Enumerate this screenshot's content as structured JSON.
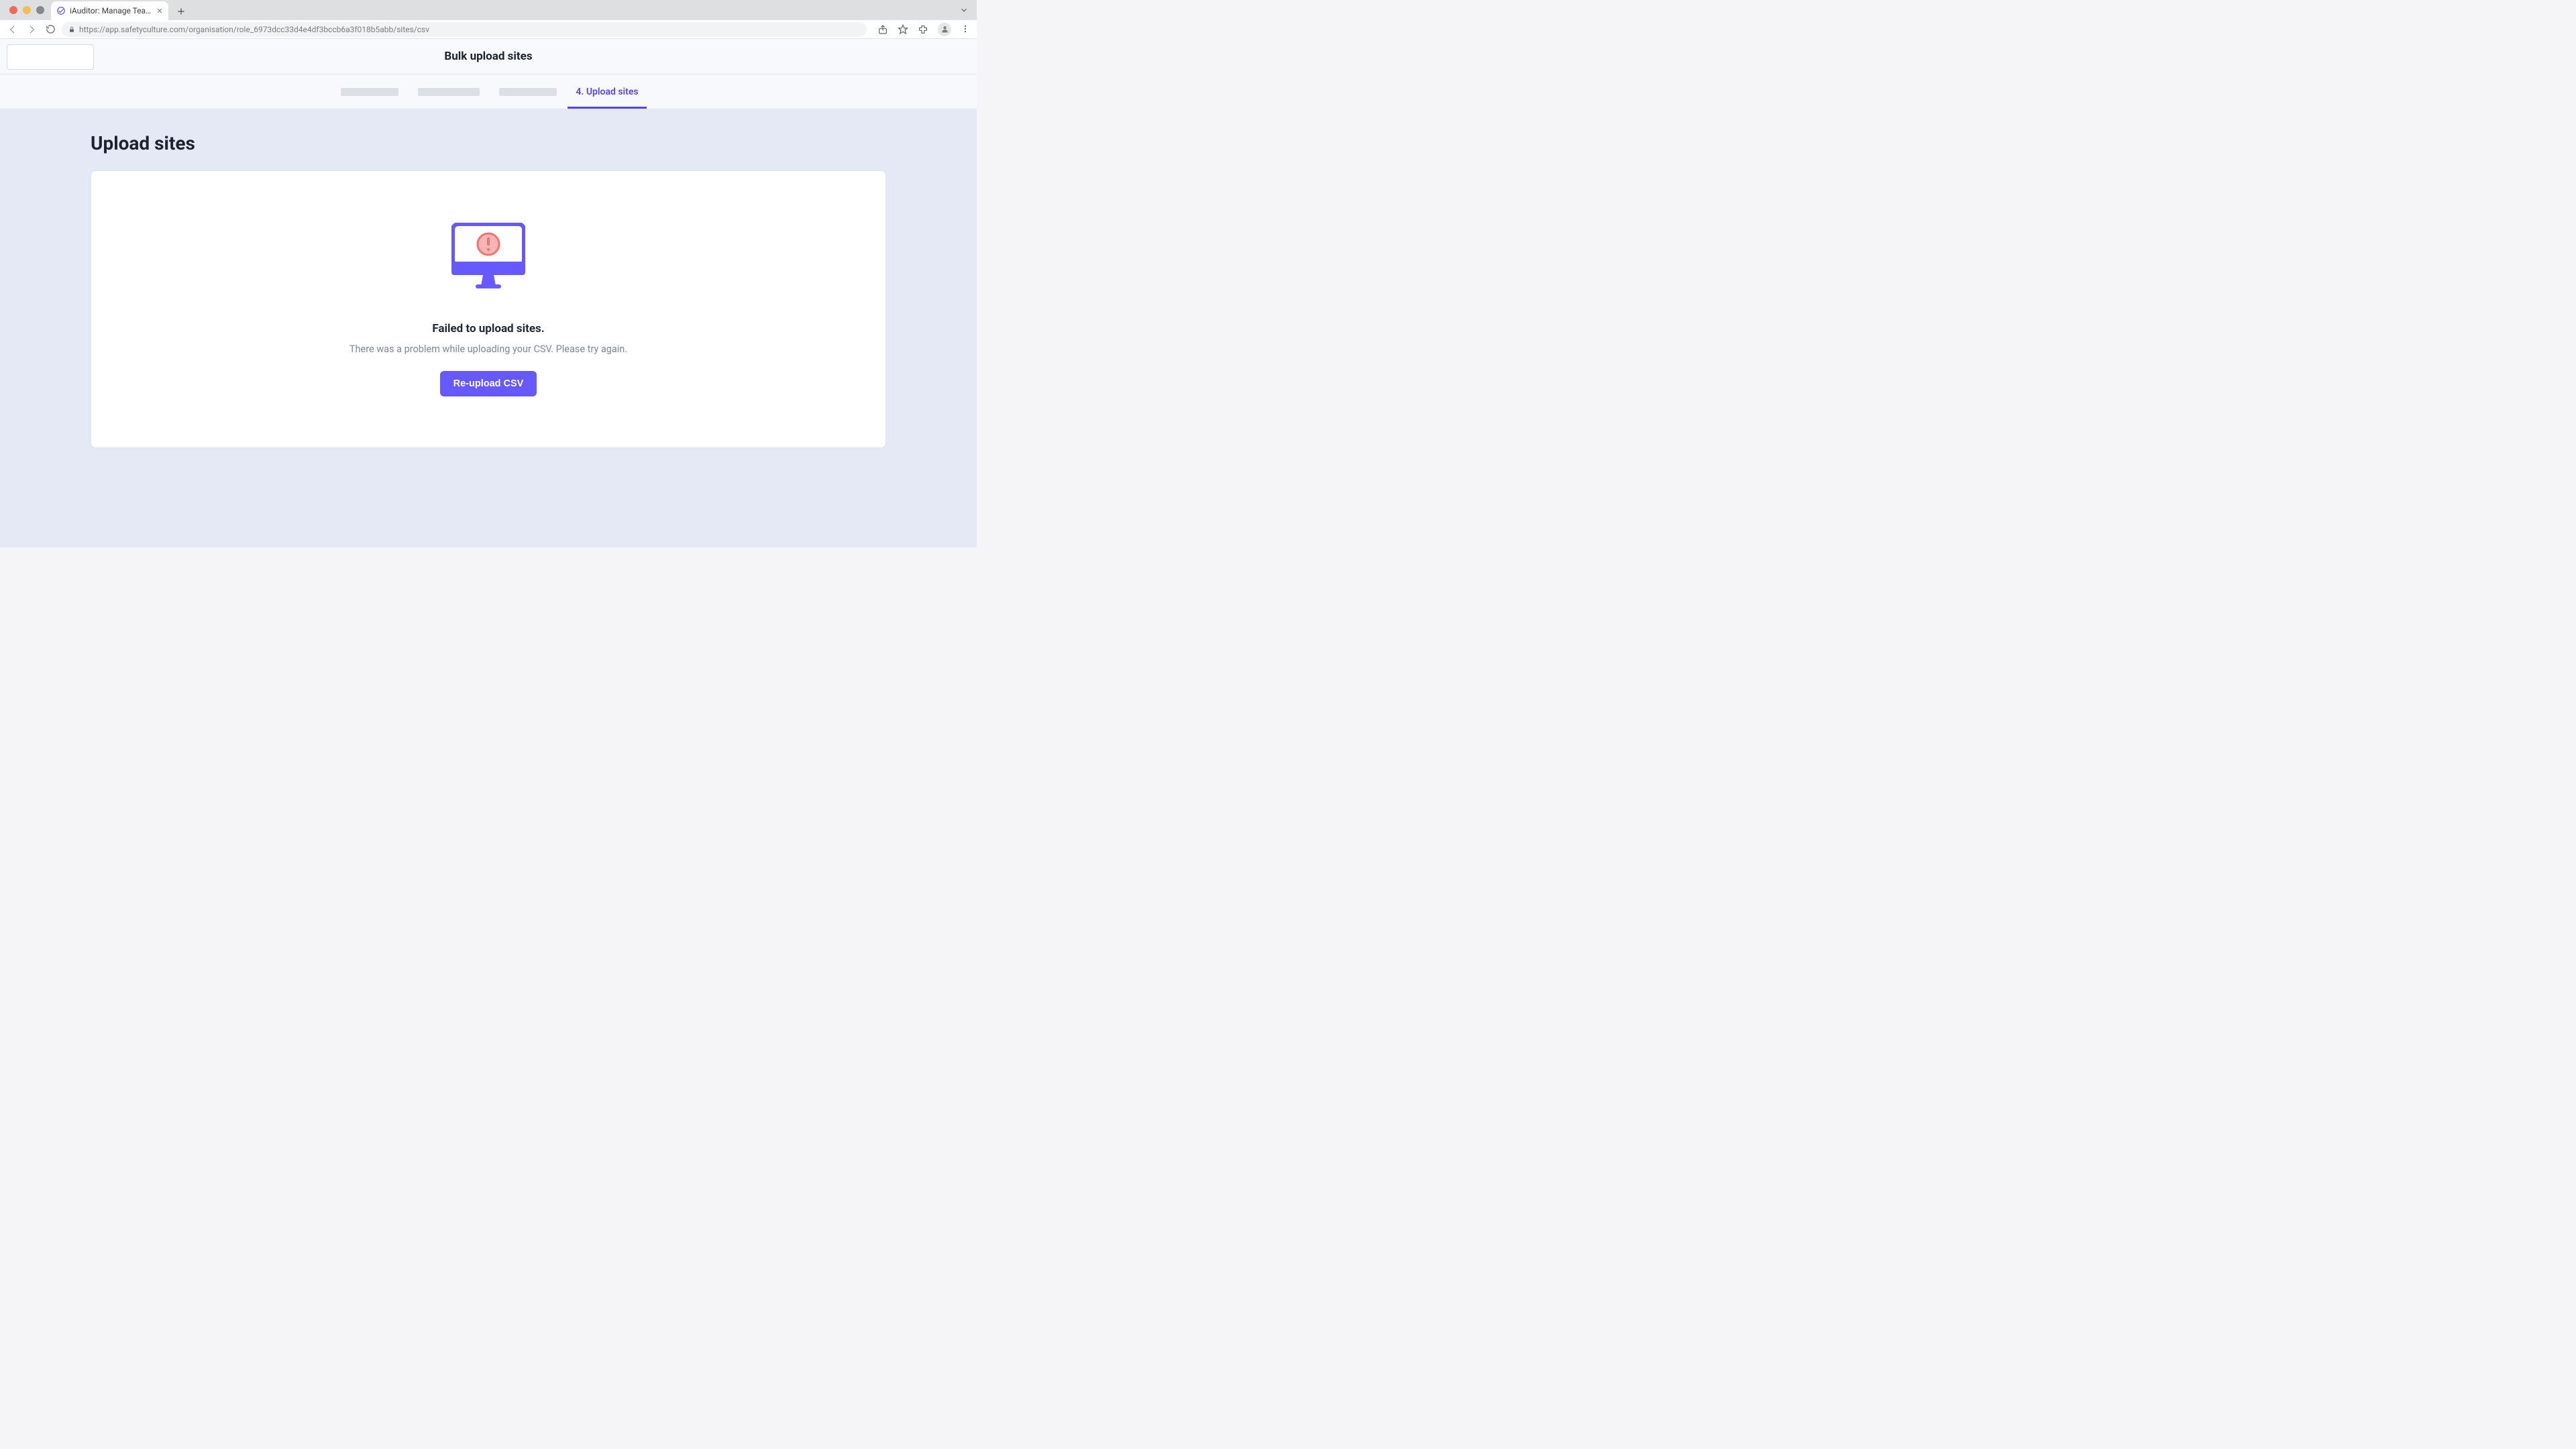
{
  "browser": {
    "tab_title": "iAuditor: Manage Teams and In",
    "url": "https://app.safetyculture.com/organisation/role_6973dcc33d4e4df3bccb6a3f018b5abb/sites/csv"
  },
  "header": {
    "title": "Bulk upload sites"
  },
  "steps": {
    "active_label": "4. Upload sites"
  },
  "page": {
    "heading": "Upload sites",
    "error_title": "Failed to upload sites.",
    "error_desc": "There was a problem while uploading your CSV. Please try again.",
    "reupload_button": "Re-upload CSV"
  }
}
